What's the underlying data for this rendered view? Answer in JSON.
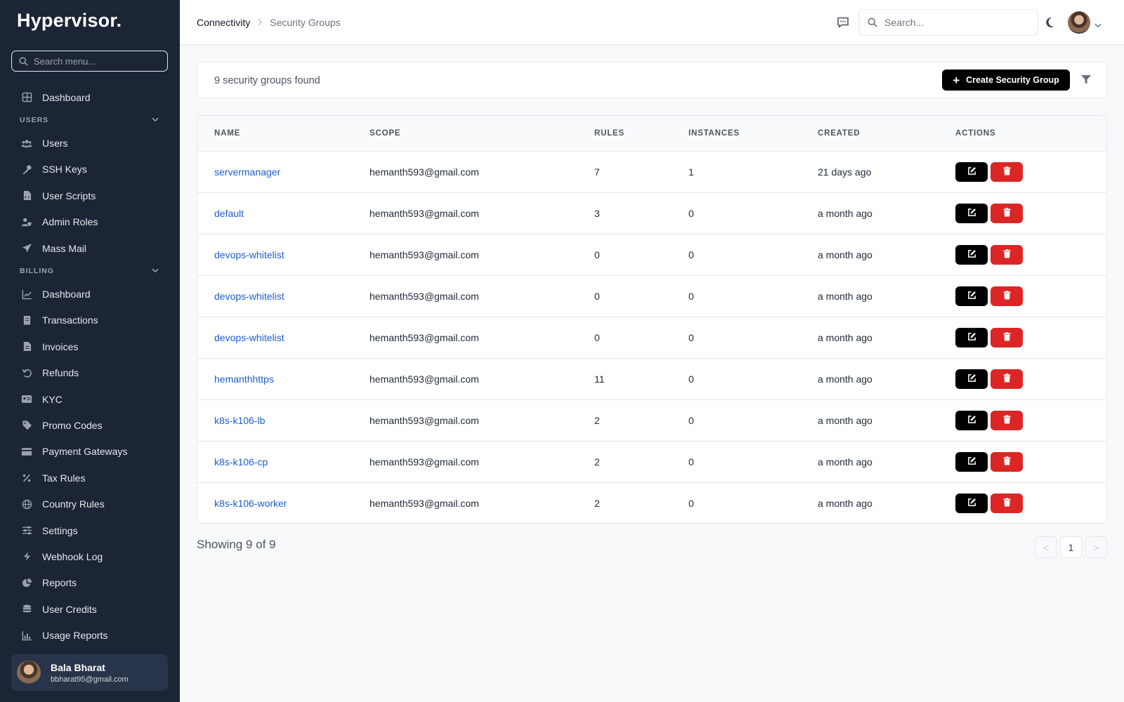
{
  "brand": "Hypervisor.",
  "sidebar": {
    "search_placeholder": "Search menu...",
    "top_items": [
      {
        "label": "Dashboard",
        "icon": "grid-icon"
      }
    ],
    "sections": [
      {
        "title": "USERS",
        "items": [
          {
            "label": "Users",
            "icon": "users-icon"
          },
          {
            "label": "SSH Keys",
            "icon": "key-icon"
          },
          {
            "label": "User Scripts",
            "icon": "script-file-icon"
          },
          {
            "label": "Admin Roles",
            "icon": "user-shield-icon"
          },
          {
            "label": "Mass Mail",
            "icon": "paper-plane-icon"
          }
        ]
      },
      {
        "title": "BILLING",
        "items": [
          {
            "label": "Dashboard",
            "icon": "line-chart-icon"
          },
          {
            "label": "Transactions",
            "icon": "receipt-icon"
          },
          {
            "label": "Invoices",
            "icon": "invoice-icon"
          },
          {
            "label": "Refunds",
            "icon": "undo-icon"
          },
          {
            "label": "KYC",
            "icon": "id-card-icon"
          },
          {
            "label": "Promo Codes",
            "icon": "tag-icon"
          },
          {
            "label": "Payment Gateways",
            "icon": "credit-card-icon"
          },
          {
            "label": "Tax Rules",
            "icon": "percent-icon"
          },
          {
            "label": "Country Rules",
            "icon": "globe-icon"
          },
          {
            "label": "Settings",
            "icon": "sliders-icon"
          },
          {
            "label": "Webhook Log",
            "icon": "bolt-icon"
          },
          {
            "label": "Reports",
            "icon": "pie-chart-icon"
          },
          {
            "label": "User Credits",
            "icon": "coins-icon"
          },
          {
            "label": "Usage Reports",
            "icon": "bar-chart-icon"
          }
        ]
      }
    ],
    "user": {
      "name": "Bala Bharat",
      "email": "bbharat95@gmail.com"
    }
  },
  "header": {
    "breadcrumb": [
      "Connectivity",
      "Security Groups"
    ],
    "search_placeholder": "Search..."
  },
  "toolbar": {
    "count_text": "9 security groups found",
    "create_label": "Create Security Group"
  },
  "table": {
    "columns": [
      "NAME",
      "SCOPE",
      "RULES",
      "INSTANCES",
      "CREATED",
      "ACTIONS"
    ],
    "rows": [
      {
        "name": "servermanager",
        "scope": "hemanth593@gmail.com",
        "rules": "7",
        "instances": "1",
        "created": "21 days ago"
      },
      {
        "name": "default",
        "scope": "hemanth593@gmail.com",
        "rules": "3",
        "instances": "0",
        "created": "a month ago"
      },
      {
        "name": "devops-whitelist",
        "scope": "hemanth593@gmail.com",
        "rules": "0",
        "instances": "0",
        "created": "a month ago"
      },
      {
        "name": "devops-whitelist",
        "scope": "hemanth593@gmail.com",
        "rules": "0",
        "instances": "0",
        "created": "a month ago"
      },
      {
        "name": "devops-whitelist",
        "scope": "hemanth593@gmail.com",
        "rules": "0",
        "instances": "0",
        "created": "a month ago"
      },
      {
        "name": "hemanthhttps",
        "scope": "hemanth593@gmail.com",
        "rules": "11",
        "instances": "0",
        "created": "a month ago"
      },
      {
        "name": "k8s-k106-lb",
        "scope": "hemanth593@gmail.com",
        "rules": "2",
        "instances": "0",
        "created": "a month ago"
      },
      {
        "name": "k8s-k106-cp",
        "scope": "hemanth593@gmail.com",
        "rules": "2",
        "instances": "0",
        "created": "a month ago"
      },
      {
        "name": "k8s-k106-worker",
        "scope": "hemanth593@gmail.com",
        "rules": "2",
        "instances": "0",
        "created": "a month ago"
      }
    ]
  },
  "footer": {
    "showing_text": "Showing 9 of 9",
    "pagination": {
      "prev": "<",
      "current": "1",
      "next": ">"
    }
  },
  "colors": {
    "sidebar_bg": "#1c2536",
    "link": "#1d5fd1",
    "danger": "#dc2626",
    "primary": "#000000"
  }
}
